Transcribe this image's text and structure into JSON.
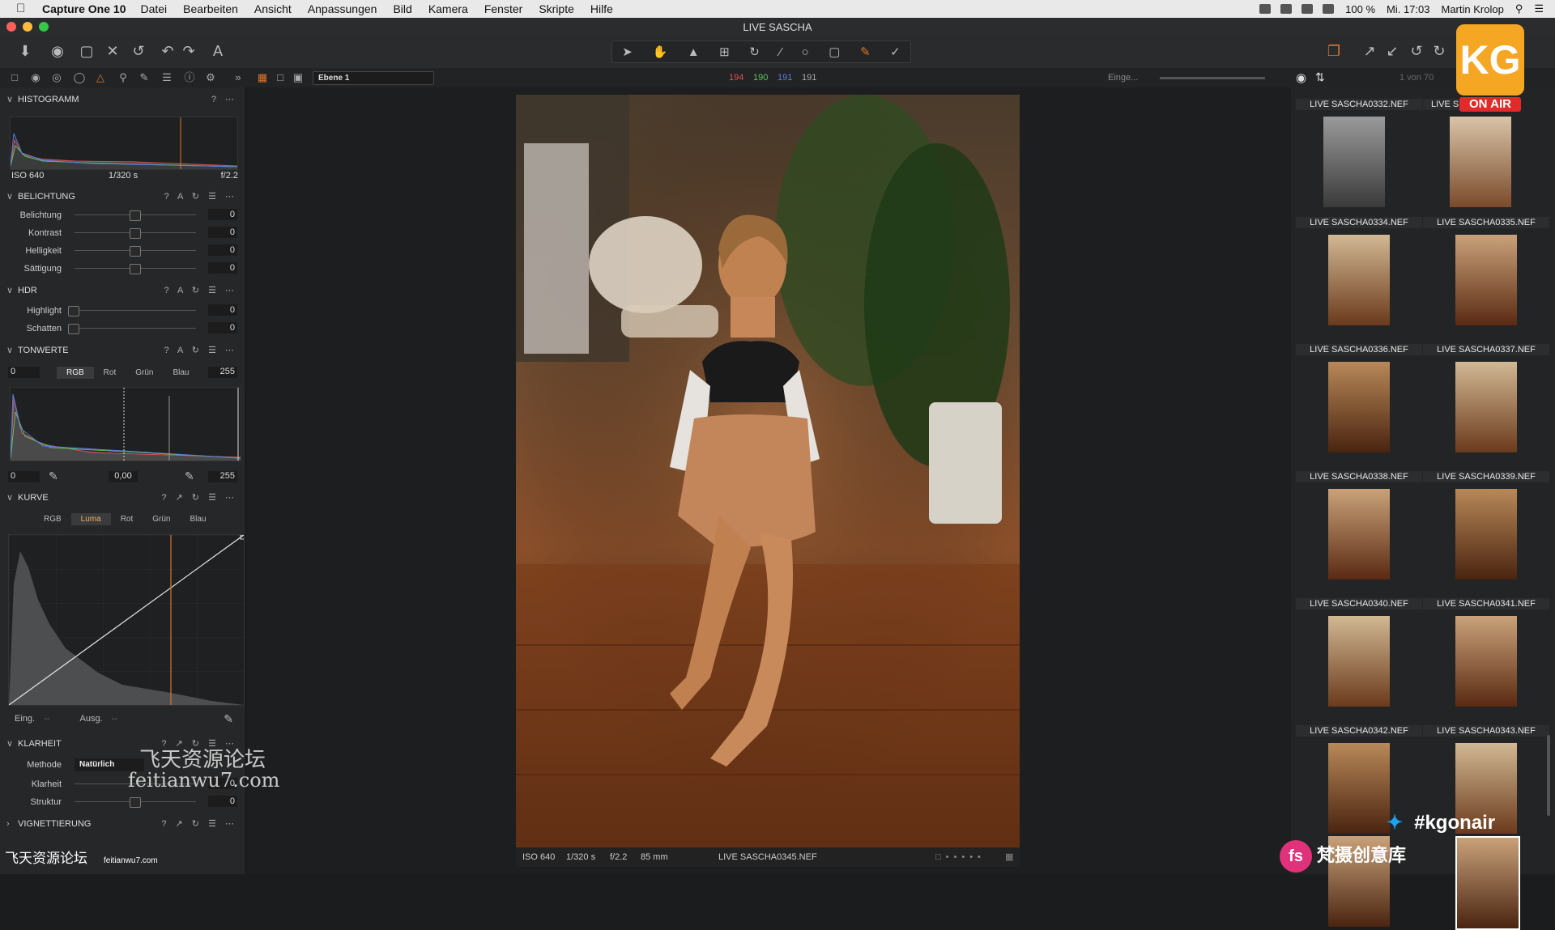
{
  "menubar": {
    "app": "Capture One 10",
    "items": [
      "Datei",
      "Bearbeiten",
      "Ansicht",
      "Anpassungen",
      "Bild",
      "Kamera",
      "Fenster",
      "Skripte",
      "Hilfe"
    ],
    "battery": "100 %",
    "clock": "Mi. 17:03",
    "user": "Martin Krolop"
  },
  "window": {
    "title": "LIVE SASCHA"
  },
  "subbar": {
    "layer": "Ebene 1",
    "rgb": {
      "r": "194",
      "g": "190",
      "b": "191",
      "l": "191"
    },
    "input_label": "Einge...",
    "count": "1 von 70"
  },
  "colors": {
    "accent": "#e0742a",
    "red": "#e05050",
    "green": "#5fc25f",
    "blue": "#5a7de0"
  },
  "histogram": {
    "title": "HISTOGRAMM",
    "iso": "ISO 640",
    "shutter": "1/320 s",
    "aperture": "f/2.2"
  },
  "exposure": {
    "title": "BELICHTUNG",
    "rows": [
      {
        "label": "Belichtung",
        "value": "0"
      },
      {
        "label": "Kontrast",
        "value": "0"
      },
      {
        "label": "Helligkeit",
        "value": "0"
      },
      {
        "label": "Sättigung",
        "value": "0"
      }
    ]
  },
  "hdr": {
    "title": "HDR",
    "rows": [
      {
        "label": "Highlight",
        "value": "0"
      },
      {
        "label": "Schatten",
        "value": "0"
      }
    ]
  },
  "levels": {
    "title": "TONWERTE",
    "in_low": "0",
    "in_high": "255",
    "tabs": [
      "RGB",
      "Rot",
      "Grün",
      "Blau"
    ],
    "out_low": "0",
    "mid": "0,00",
    "out_high": "255"
  },
  "curve": {
    "title": "KURVE",
    "tabs": [
      "RGB",
      "Luma",
      "Rot",
      "Grün",
      "Blau"
    ],
    "in_label": "Eing.",
    "in_value": "--",
    "out_label": "Ausg.",
    "out_value": "--"
  },
  "clarity": {
    "title": "KLARHEIT",
    "method_label": "Methode",
    "method_value": "Natürlich",
    "rows": [
      {
        "label": "Klarheit",
        "value": "0"
      },
      {
        "label": "Struktur",
        "value": "0"
      }
    ]
  },
  "vignette": {
    "title": "VIGNETTIERUNG"
  },
  "photo": {
    "iso": "ISO 640",
    "shutter": "1/320 s",
    "aperture": "f/2.2",
    "focal": "85 mm",
    "filename": "LIVE SASCHA0345.NEF"
  },
  "browser": {
    "header": [
      "LIVE SASCHA0332.NEF",
      "LIVE S"
    ],
    "thumbs": [
      "LIVE SASCHA0334.NEF",
      "LIVE SASCHA0335.NEF",
      "LIVE SASCHA0336.NEF",
      "LIVE SASCHA0337.NEF",
      "LIVE SASCHA0338.NEF",
      "LIVE SASCHA0339.NEF",
      "LIVE SASCHA0340.NEF",
      "LIVE SASCHA0341.NEF",
      "LIVE SASCHA0342.NEF",
      "LIVE SASCHA0343.NEF"
    ]
  },
  "overlays": {
    "onair": "ON AIR",
    "twitter": "#kgonair",
    "wm_cn": "飞天资源论坛",
    "wm_url": "feitianwu7.com",
    "wm_small_cn": "飞天资源论坛",
    "wm_small_url": "feitianwu7.com",
    "fs_text": "梵摄创意库"
  }
}
